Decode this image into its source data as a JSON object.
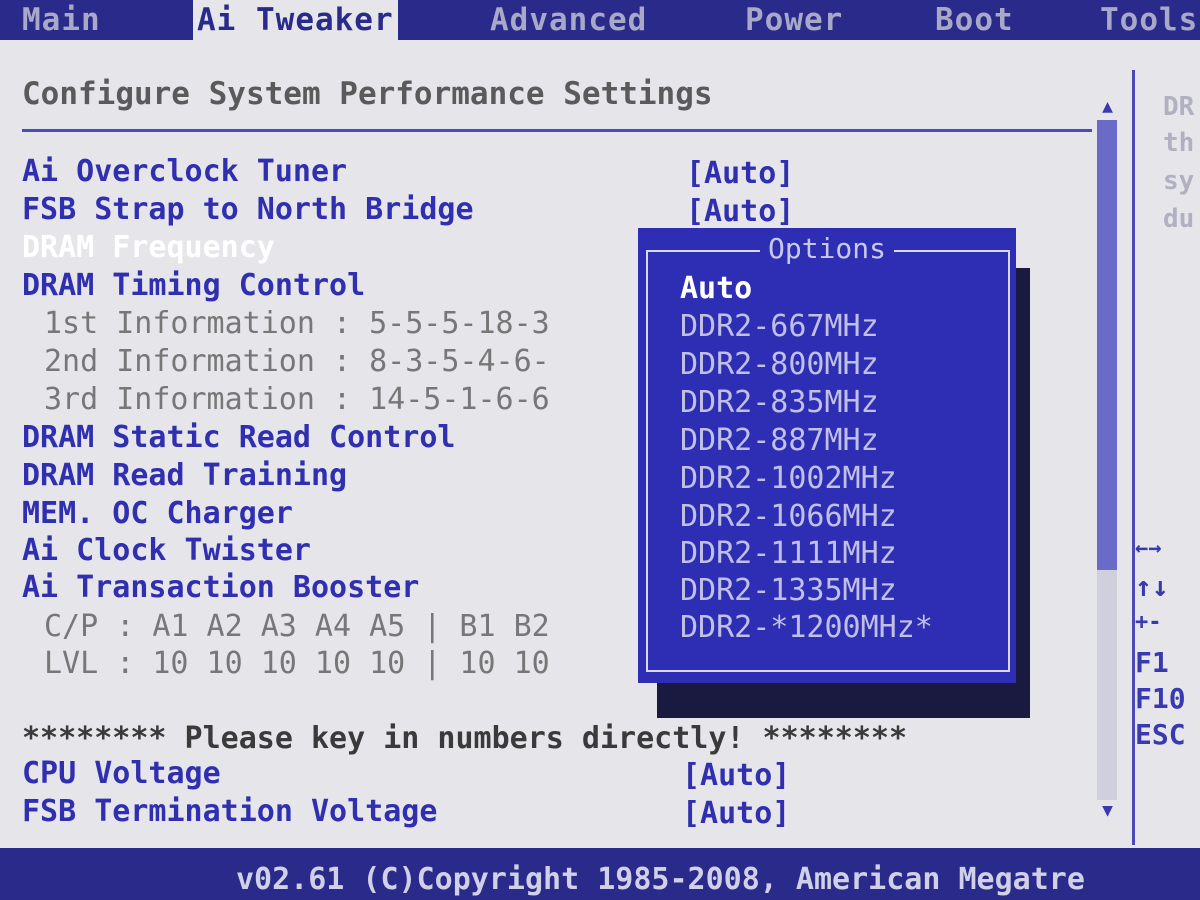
{
  "menu": {
    "tabs": [
      {
        "label": "Main"
      },
      {
        "label": "Ai Tweaker"
      },
      {
        "label": "Advanced"
      },
      {
        "label": "Power"
      },
      {
        "label": "Boot"
      },
      {
        "label": "Tools"
      }
    ],
    "active_tab": "Ai Tweaker"
  },
  "main": {
    "section_title": "Configure System Performance Settings",
    "settings": [
      {
        "label": "Ai Overclock Tuner",
        "value": "[Auto]"
      },
      {
        "label": "FSB Strap to North Bridge",
        "value": "[Auto]"
      },
      {
        "label": "DRAM Frequency",
        "value": ""
      },
      {
        "label": "DRAM Timing Control",
        "value": ""
      },
      {
        "label": "1st Information : 5-5-5-18-3"
      },
      {
        "label": "2nd Information : 8-3-5-4-6-"
      },
      {
        "label": "3rd Information : 14-5-1-6-6"
      },
      {
        "label": "DRAM Static Read Control"
      },
      {
        "label": "DRAM Read Training"
      },
      {
        "label": "MEM. OC Charger"
      },
      {
        "label": "Ai Clock Twister"
      },
      {
        "label": "Ai Transaction Booster"
      },
      {
        "label": "C/P : A1 A2 A3 A4 A5 | B1 B2"
      },
      {
        "label": "LVL : 10 10 10 10 10 | 10 10"
      },
      {
        "label": "******** Please key in numbers directly! ********"
      },
      {
        "label": "CPU Voltage",
        "value": "[Auto]"
      },
      {
        "label": "FSB Termination Voltage",
        "value": "[Auto]"
      }
    ],
    "selected_setting": "DRAM Frequency"
  },
  "options_popup": {
    "title": "Options",
    "options": [
      "Auto",
      "DDR2-667MHz",
      "DDR2-800MHz",
      "DDR2-835MHz",
      "DDR2-887MHz",
      "DDR2-1002MHz",
      "DDR2-1066MHz",
      "DDR2-1111MHz",
      "DDR2-1335MHz",
      "DDR2-*1200MHz*"
    ],
    "selected": "Auto"
  },
  "help_panel": {
    "help_lines": [
      "DR",
      "th",
      "sy",
      "du"
    ],
    "key_hints": [
      "←→",
      "↑↓",
      "+-",
      "F1",
      "F10",
      "ESC"
    ]
  },
  "scrollbar": {
    "up_icon": "triangle-up",
    "down_icon": "triangle-down"
  },
  "status_bar": {
    "text": "v02.61 (C)Copyright 1985-2008, American Megatre"
  },
  "colors": {
    "bar_blue": "#2a2a8a",
    "label_blue": "#2f2fb0",
    "popup_blue": "#2e2eb4",
    "background": "#e6e6ea"
  }
}
